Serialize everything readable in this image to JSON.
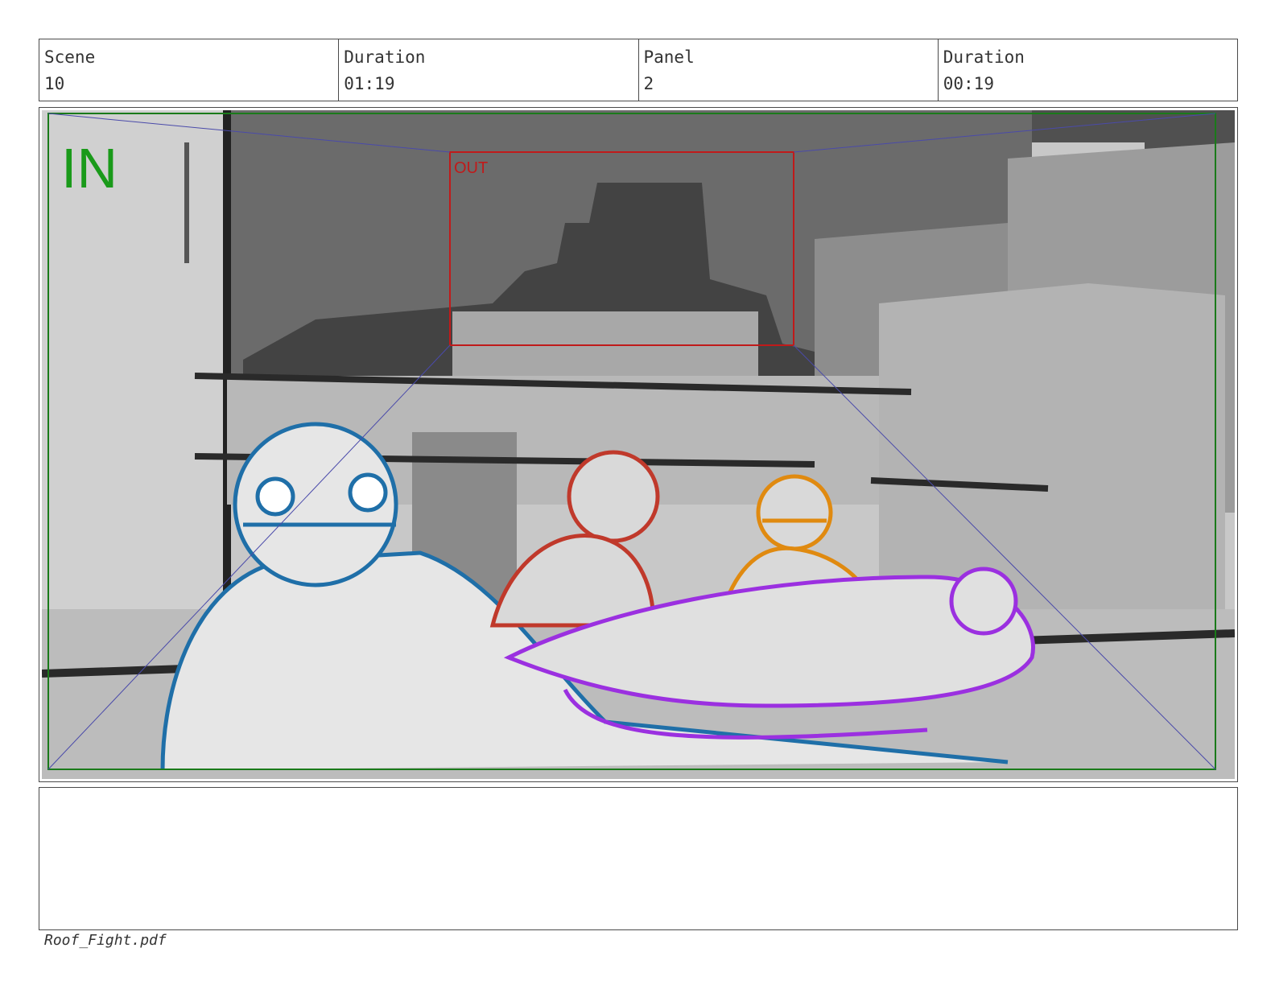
{
  "header": {
    "scene_label": "Scene",
    "scene_value": "10",
    "scene_duration_label": "Duration",
    "scene_duration_value": "01:19",
    "panel_label": "Panel",
    "panel_value": "2",
    "panel_duration_label": "Duration",
    "panel_duration_value": "00:19"
  },
  "frame": {
    "in_label": "IN",
    "out_label": "OUT",
    "colors": {
      "in_green": "#1a9a1a",
      "out_red": "#c01a1a",
      "blue_char": "#1f6fa8",
      "red_char": "#c0392b",
      "orange_char": "#e08a10",
      "purple_char": "#9b30e0"
    }
  },
  "notes": {
    "text": ""
  },
  "footer": {
    "filename": "Roof_Fight.pdf"
  }
}
